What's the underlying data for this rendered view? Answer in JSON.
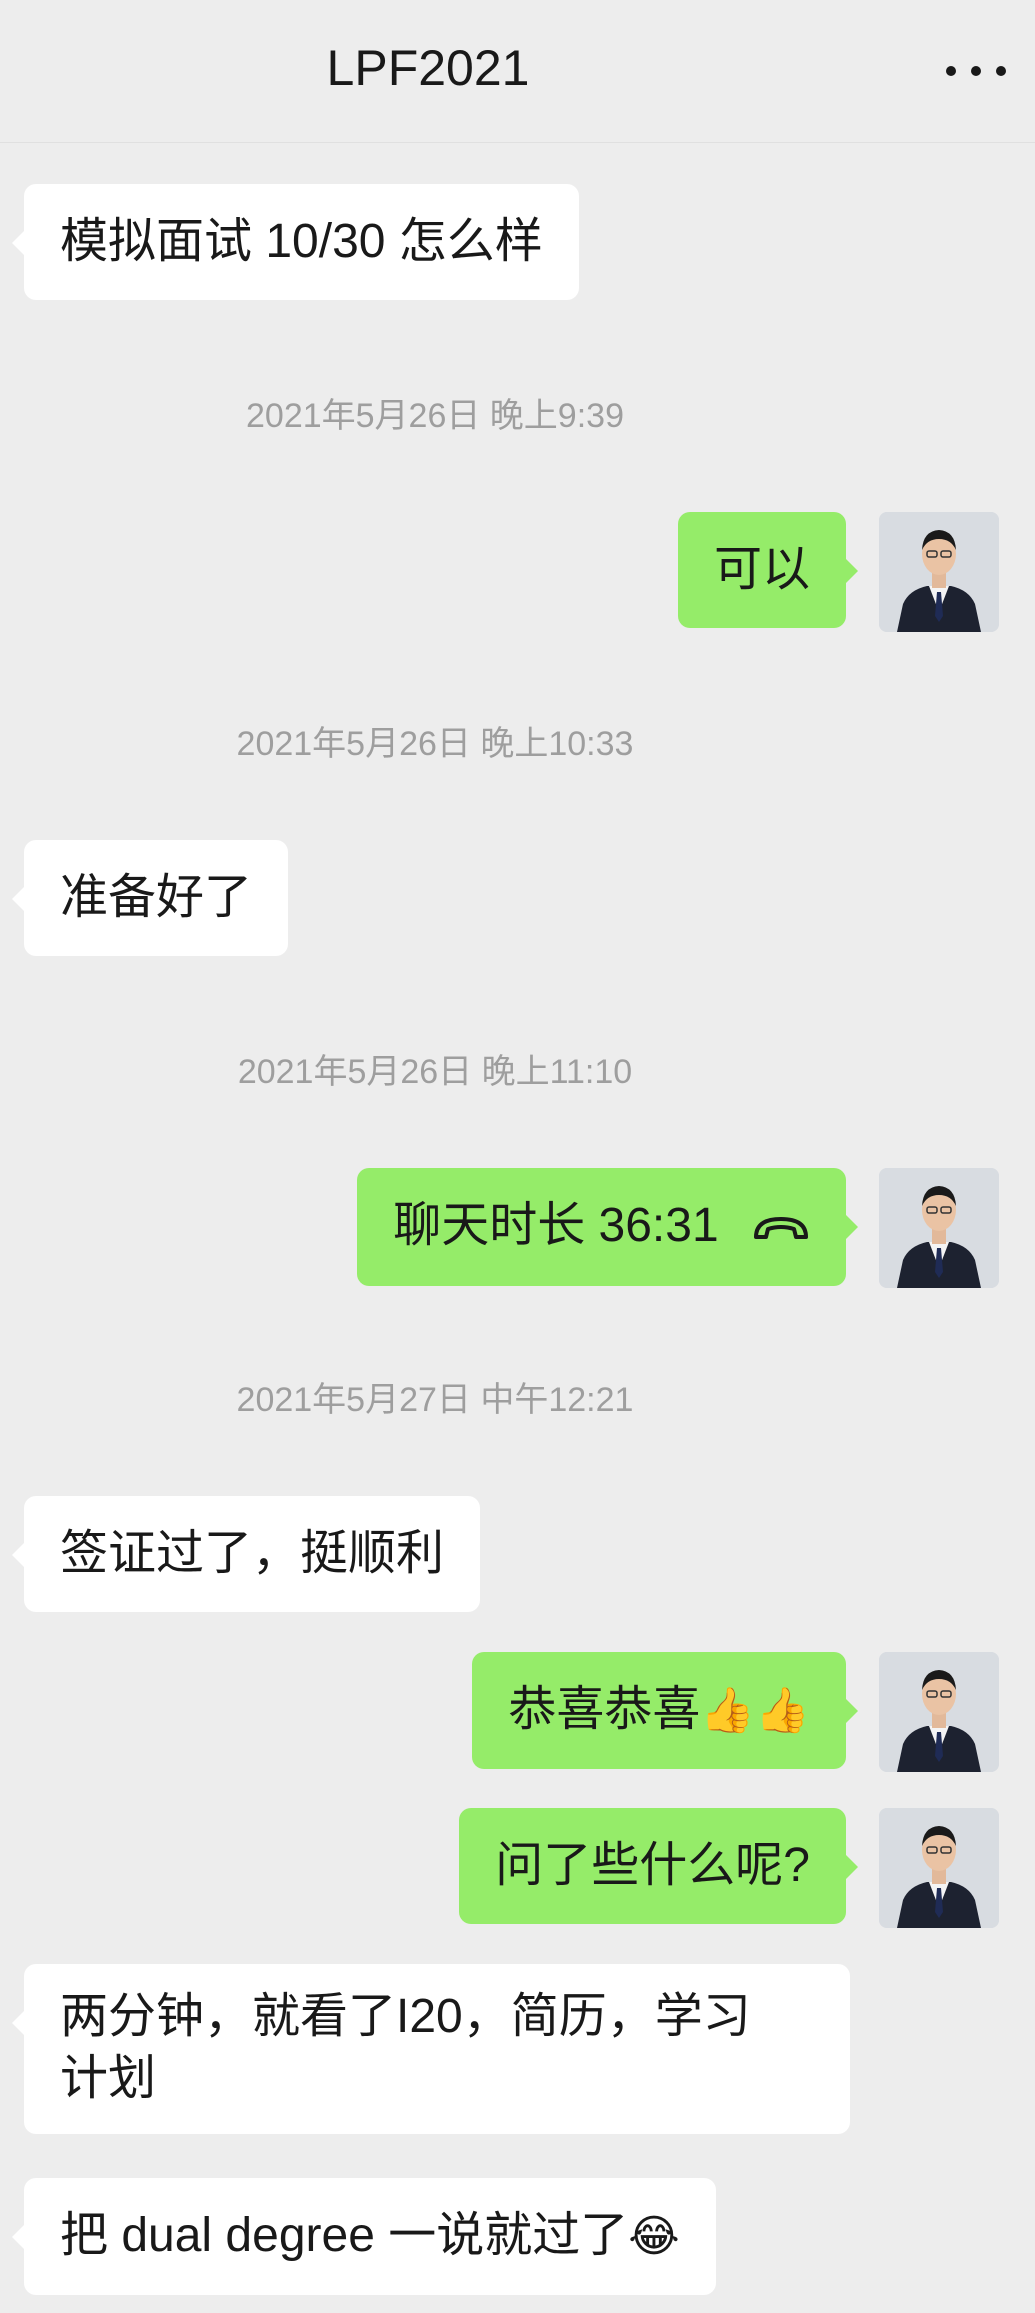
{
  "header": {
    "title": "LPF2021",
    "more_icon": "more-dots-icon"
  },
  "messages": [
    {
      "side": "left",
      "text": "模拟面试 10/30 怎么样"
    },
    {
      "timestamp": "2021年5月26日 晚上9:39"
    },
    {
      "side": "right",
      "text": "可以"
    },
    {
      "timestamp": "2021年5月26日 晚上10:33"
    },
    {
      "side": "left",
      "text": "准备好了"
    },
    {
      "timestamp": "2021年5月26日 晚上11:10"
    },
    {
      "side": "right",
      "text": "聊天时长 36:31",
      "icon": "phone-hangup-icon"
    },
    {
      "timestamp": "2021年5月27日 中午12:21"
    },
    {
      "side": "left",
      "text": "签证过了，挺顺利"
    },
    {
      "side": "right",
      "text": "恭喜恭喜",
      "emoji": "👍👍"
    },
    {
      "side": "right",
      "text": "问了些什么呢?"
    },
    {
      "side": "left",
      "line1": "两分钟，就看了I20，简历，学习",
      "line2": "计划"
    },
    {
      "side": "left",
      "text": "把 dual degree 一说就过了",
      "emoji": "😂"
    }
  ],
  "colors": {
    "background": "#ededed",
    "incoming_bubble": "#ffffff",
    "outgoing_bubble": "#95ec69",
    "timestamp": "#9e9e9e"
  }
}
